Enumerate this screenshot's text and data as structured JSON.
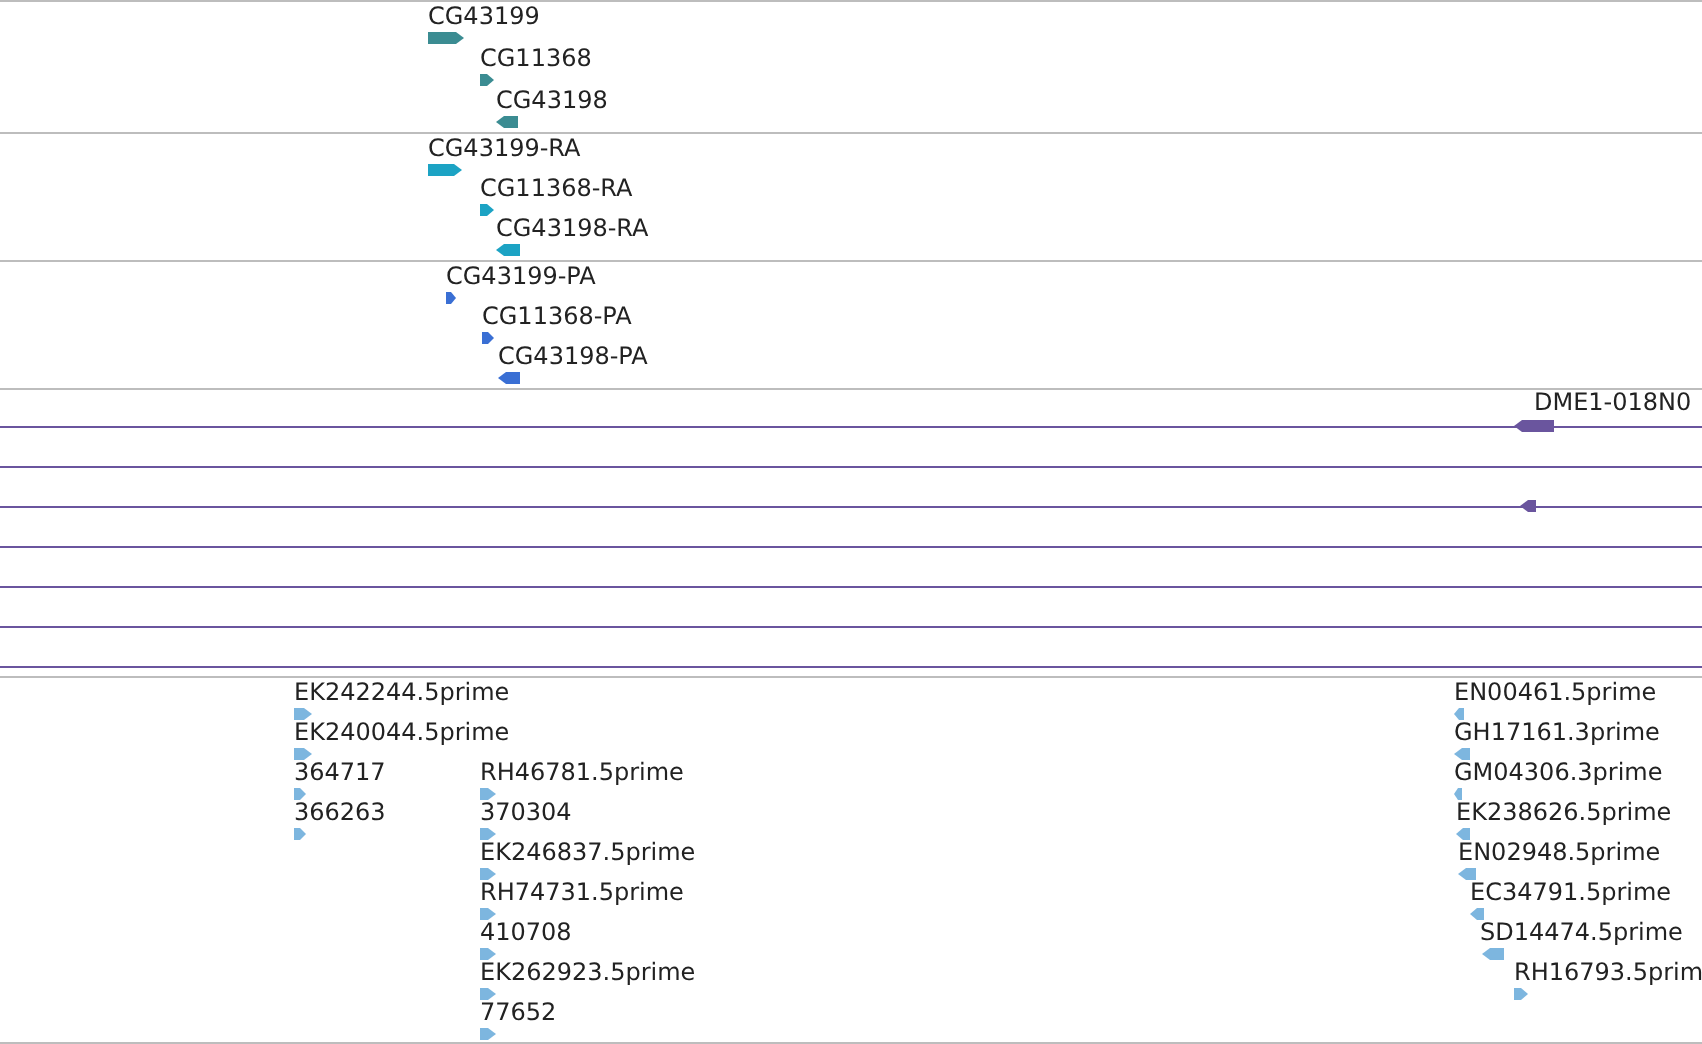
{
  "tracks": [
    {
      "kind": "genes",
      "color": "#3b8c92",
      "features": [
        {
          "label": "CG43199",
          "reverse": false
        },
        {
          "label": "CG11368",
          "reverse": false
        },
        {
          "label": "CG43198",
          "reverse": true
        }
      ]
    },
    {
      "kind": "genes",
      "color": "#1ca3c4",
      "features": [
        {
          "label": "CG43199-RA",
          "reverse": false
        },
        {
          "label": "CG11368-RA",
          "reverse": false
        },
        {
          "label": "CG43198-RA",
          "reverse": true
        }
      ]
    },
    {
      "kind": "genes",
      "color": "#3a6fd4",
      "features": [
        {
          "label": "CG43199-PA",
          "reverse": false
        },
        {
          "label": "CG11368-PA",
          "reverse": false
        },
        {
          "label": "CG43198-PA",
          "reverse": true
        }
      ]
    },
    {
      "kind": "alignments",
      "color": "#6a559e",
      "rows": [
        {
          "features": [
            {
              "label": "DME1-018N0",
              "reverse": true
            }
          ]
        },
        {},
        {
          "features": [
            {
              "reverse": true
            }
          ]
        },
        {},
        {},
        {},
        {}
      ]
    },
    {
      "kind": "genes",
      "color": "#7db6df",
      "features": [
        {
          "label": "EK242244.5prime",
          "reverse": false
        },
        {
          "label": "EK240044.5prime",
          "reverse": false
        },
        {
          "label": "364717",
          "reverse": false
        },
        {
          "label": "366263",
          "reverse": false
        },
        {
          "label": "RH46781.5prime",
          "reverse": false
        },
        {
          "label": "370304",
          "reverse": false
        },
        {
          "label": "EK246837.5prime",
          "reverse": false
        },
        {
          "label": "RH74731.5prime",
          "reverse": false
        },
        {
          "label": "410708",
          "reverse": false
        },
        {
          "label": "EK262923.5prime",
          "reverse": false
        },
        {
          "label": "77652",
          "reverse": false
        },
        {
          "label": "EN00461.5prime",
          "reverse": true
        },
        {
          "label": "GH17161.3prime",
          "reverse": true
        },
        {
          "label": "GM04306.3prime",
          "reverse": true
        },
        {
          "label": "EK238626.5prime",
          "reverse": true
        },
        {
          "label": "EN02948.5prime",
          "reverse": true
        },
        {
          "label": "EC34791.5prime",
          "reverse": true
        },
        {
          "label": "SD14474.5prime",
          "reverse": true
        },
        {
          "label": "RH16793.5prim",
          "reverse": false
        }
      ]
    }
  ]
}
